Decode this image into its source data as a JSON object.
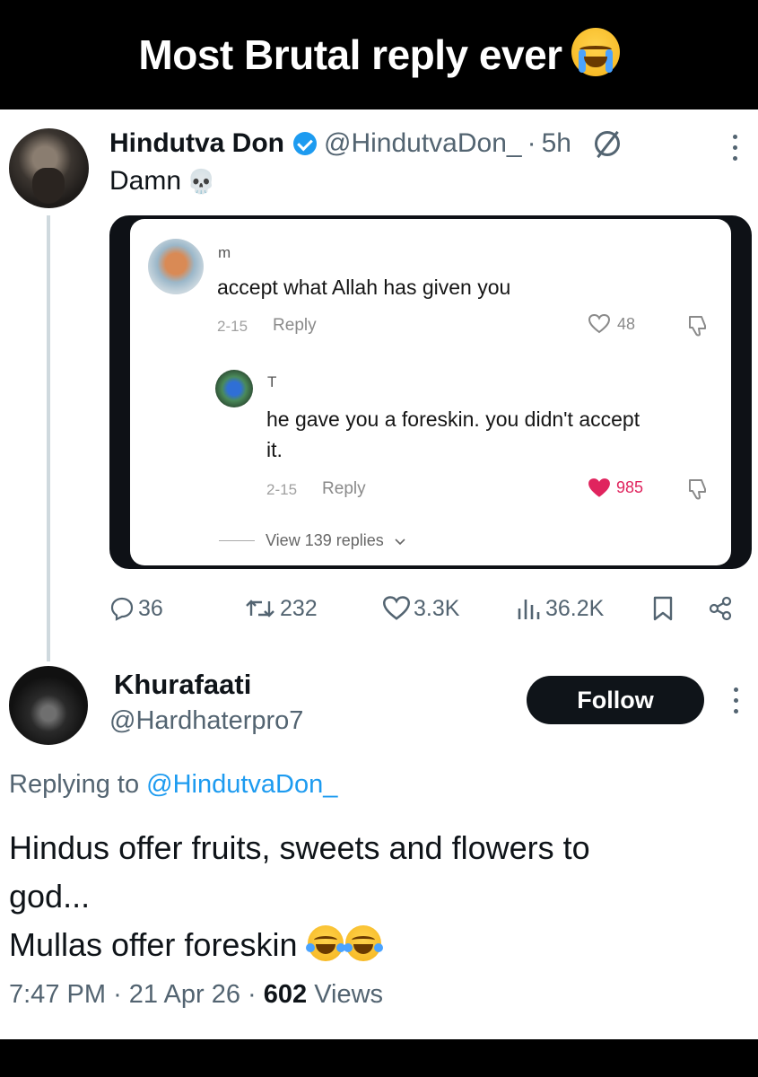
{
  "banner": {
    "title": "Most Brutal reply ever",
    "emoji": "loudly-crying-face"
  },
  "post": {
    "author_name": "Hindutva Don",
    "verified": true,
    "handle": "@HindutvaDon_",
    "separator": "·",
    "time": "5h",
    "text": "Damn",
    "text_emoji": "💀",
    "quoted_screenshot": {
      "comment": {
        "username": "m",
        "text": "accept what Allah has given you",
        "date": "2-15",
        "reply_label": "Reply",
        "likes": "48"
      },
      "reply": {
        "username": "T",
        "text_line1": "he gave you a foreskin. you didn't accept",
        "text_line2": "it.",
        "date": "2-15",
        "reply_label": "Reply",
        "likes": "985",
        "like_color": "#e0245e"
      },
      "view_replies": "View 139 replies"
    },
    "actions": {
      "replies": "36",
      "reposts": "232",
      "likes": "3.3K",
      "views": "36.2K"
    }
  },
  "reply_post": {
    "author_name": "Khurafaati",
    "handle": "@Hardhaterpro7",
    "follow_label": "Follow",
    "replying_prefix": "Replying to",
    "replying_handle": "@HindutvaDon_",
    "text_line1": "Hindus offer fruits, sweets and flowers to",
    "text_line2": "god...",
    "text_line3": "Mullas offer foreskin",
    "text_emoji": "face-with-tears-of-joy",
    "time": "7:47 PM",
    "date": "21 Apr 26",
    "separator": "·",
    "views_count": "602",
    "views_label": "Views"
  },
  "colors": {
    "link_blue": "#1d9bf0",
    "secondary_text": "#536471",
    "banner_bg": "#000000",
    "follow_bg": "#0f1419"
  }
}
